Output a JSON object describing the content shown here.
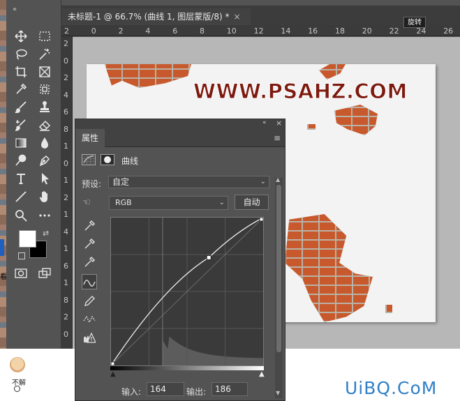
{
  "desktop": {
    "avatar_label": "不解",
    "edge_text": "看"
  },
  "document_tab": {
    "title": "未标题-1 @ 66.7% (曲线 1, 图层蒙版/8) *",
    "close": "×"
  },
  "tooltip": "旋转",
  "ruler_top": [
    "2",
    "0",
    "2",
    "4",
    "6",
    "8",
    "10",
    "12",
    "14",
    "16",
    "18",
    "20",
    "22",
    "24",
    "26"
  ],
  "ruler_left": [
    "2",
    "0",
    "2",
    "4",
    "6",
    "8",
    "1",
    "0",
    "1",
    "2",
    "1",
    "4",
    "1",
    "6",
    "1",
    "8",
    "2",
    "0"
  ],
  "canvas": {
    "headline": "WWW.PSAHZ.COM"
  },
  "properties": {
    "tab_label": "属性",
    "collapse": "«",
    "close": "×",
    "menu": "≡",
    "adjustment_title": "曲线",
    "preset_label": "预设:",
    "preset_value": "自定",
    "channel_value": "RGB",
    "auto_label": "自动",
    "input_label": "输入:",
    "input_value": "164",
    "output_label": "输出:",
    "output_value": "186",
    "curve_point": {
      "input": 164,
      "output": 186
    }
  },
  "site_watermark": "UiBQ.CoM",
  "colors": {
    "foreground": "#ffffff",
    "background": "#000000",
    "headline": "#7d1a10",
    "watermark": "#2f80c9"
  }
}
